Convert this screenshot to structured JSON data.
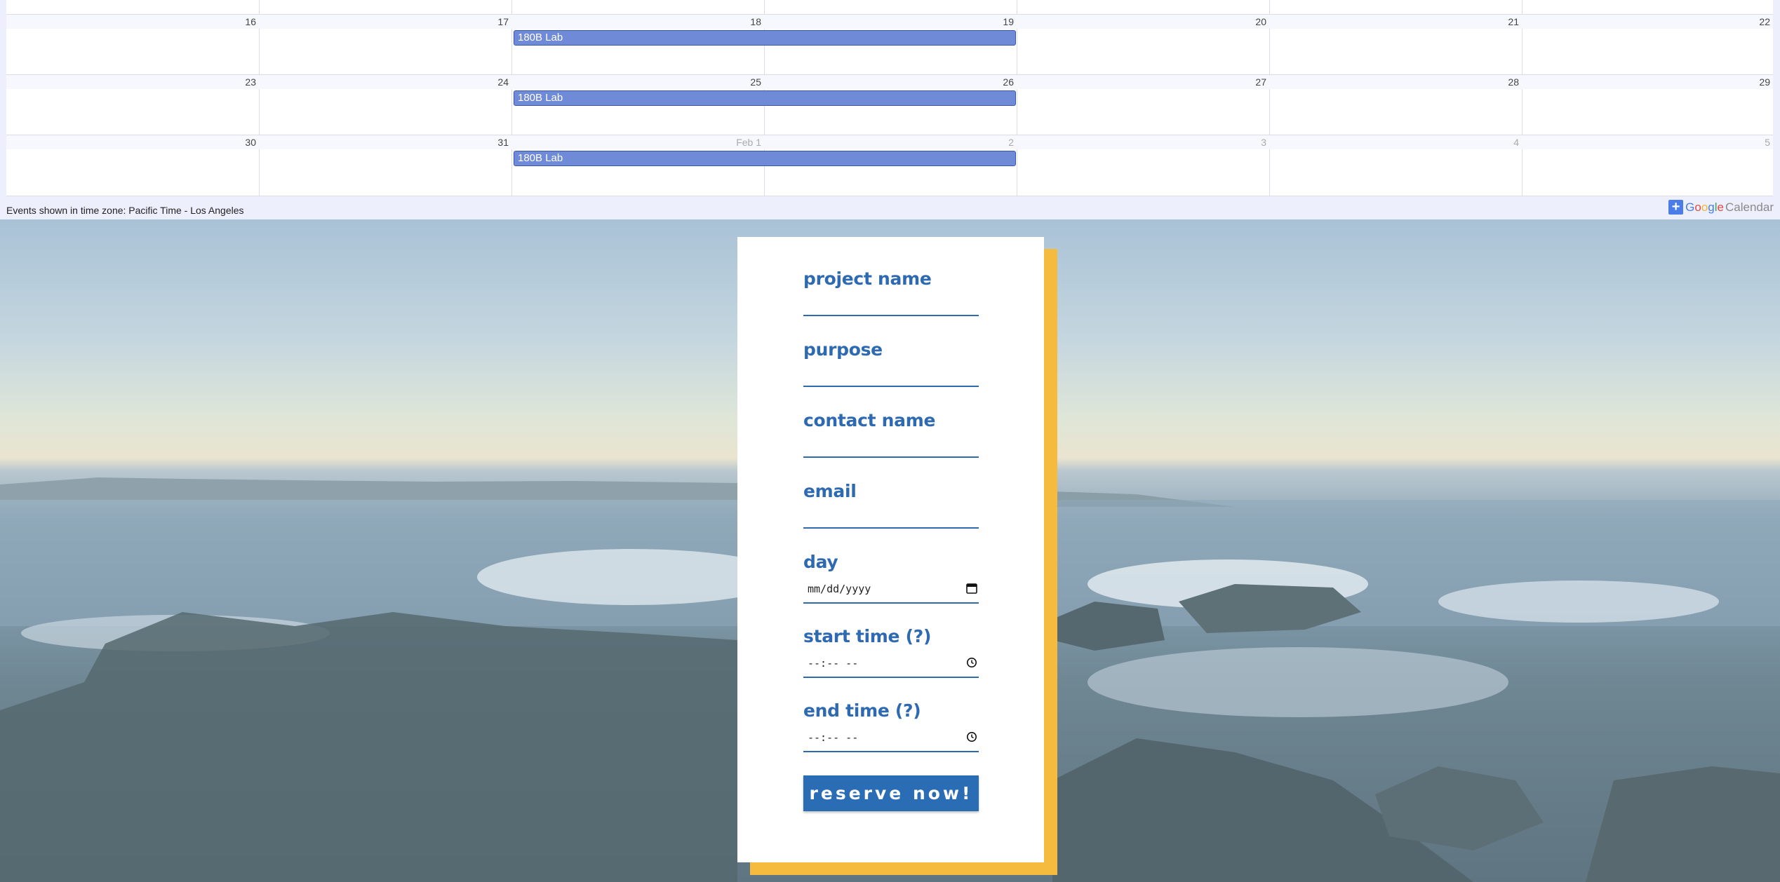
{
  "calendar": {
    "weeks": [
      {
        "days": [
          "16",
          "17",
          "18",
          "19",
          "20",
          "21",
          "22"
        ],
        "other_month": [
          false,
          false,
          false,
          false,
          false,
          false,
          false
        ],
        "event": "180B Lab"
      },
      {
        "days": [
          "23",
          "24",
          "25",
          "26",
          "27",
          "28",
          "29"
        ],
        "other_month": [
          false,
          false,
          false,
          false,
          false,
          false,
          false
        ],
        "event": "180B Lab"
      },
      {
        "days": [
          "30",
          "31",
          "Feb 1",
          "2",
          "3",
          "4",
          "5"
        ],
        "other_month": [
          false,
          false,
          true,
          true,
          true,
          true,
          true
        ],
        "event": "180B Lab"
      }
    ],
    "timezone_note": "Events shown in time zone: Pacific Time - Los Angeles",
    "badge": {
      "plus": "+",
      "google": "Google",
      "calendar": "Calendar"
    },
    "event_color": "#6f8ad6"
  },
  "form": {
    "fields": [
      {
        "label": "project name",
        "value": ""
      },
      {
        "label": "purpose",
        "value": ""
      },
      {
        "label": "contact name",
        "value": ""
      },
      {
        "label": "email",
        "value": ""
      }
    ],
    "day": {
      "label": "day",
      "placeholder": "mm/dd/yyyy",
      "icon": "calendar-icon"
    },
    "start_time": {
      "label": "start time (?)",
      "placeholder": "--:-- --",
      "icon": "clock-icon"
    },
    "end_time": {
      "label": "end time (?)",
      "placeholder": "--:-- --",
      "icon": "clock-icon"
    },
    "submit_label": "reserve now!",
    "accent_color": "#2e6ab1",
    "shadow_color": "#f4bb3f"
  }
}
